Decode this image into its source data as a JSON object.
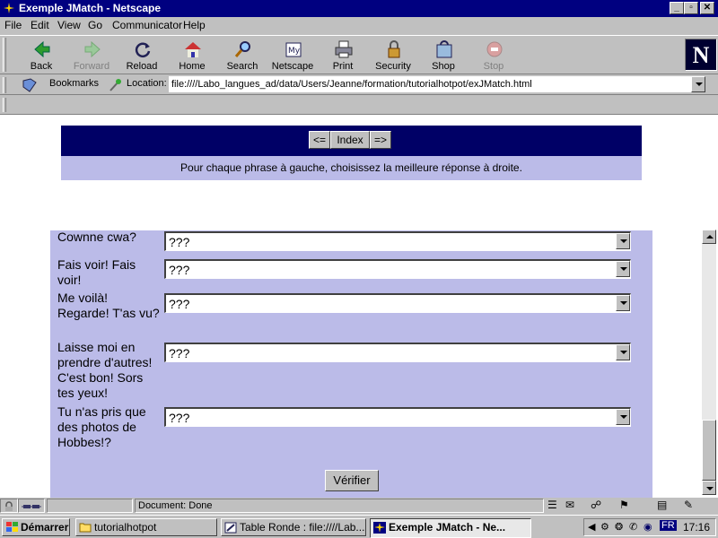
{
  "window": {
    "title": "Exemple JMatch - Netscape",
    "controls": [
      "_",
      "▫",
      "✕"
    ]
  },
  "menu": [
    "File",
    "Edit",
    "View",
    "Go",
    "Communicator",
    "Help"
  ],
  "toolbar": {
    "buttons": [
      {
        "label": "Back",
        "icon": "back-arrow-icon",
        "enabled": true
      },
      {
        "label": "Forward",
        "icon": "forward-arrow-icon",
        "enabled": false
      },
      {
        "label": "Reload",
        "icon": "reload-icon",
        "enabled": true
      },
      {
        "label": "Home",
        "icon": "home-icon",
        "enabled": true
      },
      {
        "label": "Search",
        "icon": "search-icon",
        "enabled": true
      },
      {
        "label": "Netscape",
        "icon": "netscape-icon",
        "enabled": true
      },
      {
        "label": "Print",
        "icon": "print-icon",
        "enabled": true
      },
      {
        "label": "Security",
        "icon": "lock-icon",
        "enabled": true
      },
      {
        "label": "Shop",
        "icon": "shop-icon",
        "enabled": true
      },
      {
        "label": "Stop",
        "icon": "stop-icon",
        "enabled": false
      }
    ],
    "logo": "N"
  },
  "location": {
    "bookmarks_label": "Bookmarks",
    "location_label": "Location:",
    "url": "file:////Labo_langues_ad/data/Users/Jeanne/formation/tutorialhotpot/exJMatch.html"
  },
  "page": {
    "nav": {
      "prev": "<=",
      "index": "Index",
      "next": "=>"
    },
    "instructions": "Pour chaque phrase à gauche, choisissez la meilleure réponse à droite.",
    "questions": [
      {
        "text": "Cownne cwa?",
        "value": "???"
      },
      {
        "text": "Fais voir! Fais voir!",
        "value": "???"
      },
      {
        "text": "Me voilà! Regarde! T'as vu?",
        "value": "???"
      },
      {
        "text": "Laisse moi en prendre d'autres! C'est bon! Sors tes yeux!",
        "value": "???"
      },
      {
        "text": "Tu n'as pris que des photos de Hobbes!?",
        "value": "???"
      }
    ],
    "verify_label": "Vérifier"
  },
  "status": {
    "text": "Document: Done"
  },
  "taskbar": {
    "start": "Démarrer",
    "tasks": [
      {
        "label": "tutorialhotpot",
        "active": false
      },
      {
        "label": "Table Ronde : file:////Lab...",
        "active": false
      },
      {
        "label": "Exemple JMatch - Ne...",
        "active": true
      }
    ],
    "language": "FR",
    "clock": "17:16"
  },
  "colors": {
    "title_bar": "#000080",
    "nav_bar": "#000066",
    "panel": "#bbbbe8"
  }
}
